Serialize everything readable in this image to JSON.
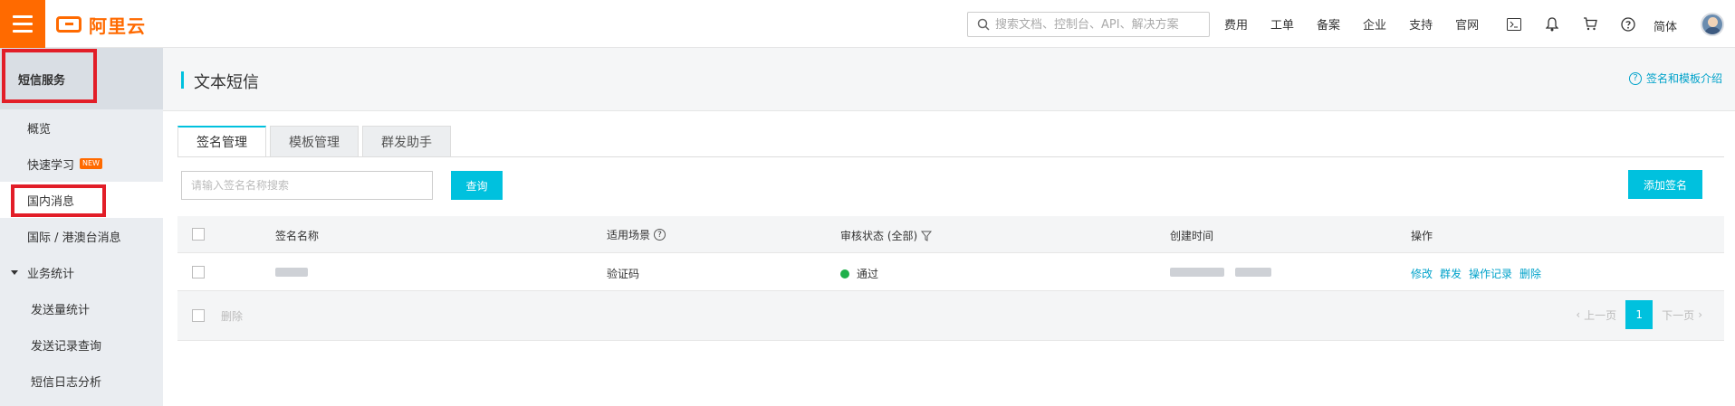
{
  "topbar": {
    "logo_text": "阿里云",
    "search_placeholder": "搜索文档、控制台、API、解决方案",
    "nav_items": [
      "费用",
      "工单",
      "备案",
      "企业",
      "支持",
      "官网"
    ],
    "icons": [
      "terminal-icon",
      "bell-icon",
      "cart-icon",
      "help-icon"
    ],
    "language": "简体"
  },
  "sidebar": {
    "title": "短信服务",
    "items": {
      "overview": "概览",
      "quick_learn": "快速学习",
      "quick_learn_badge": "NEW",
      "domestic": "国内消息",
      "international": "国际 / 港澳台消息",
      "stats_group": "业务统计",
      "send_stats": "发送量统计",
      "send_records": "发送记录查询",
      "log_analysis": "短信日志分析"
    }
  },
  "main": {
    "title": "文本短信",
    "intro_link": "签名和模板介绍",
    "tabs": [
      "签名管理",
      "模板管理",
      "群发助手"
    ],
    "search_placeholder": "请输入签名名称搜索",
    "query_button": "查询",
    "add_button": "添加签名",
    "table": {
      "headers": {
        "name": "签名名称",
        "scene": "适用场景",
        "status": "审核状态 (全部)",
        "created": "创建时间",
        "actions": "操作"
      },
      "rows": [
        {
          "scene": "验证码",
          "status": "通过",
          "actions": [
            "修改",
            "群发",
            "操作记录",
            "删除"
          ]
        }
      ],
      "footer_delete": "删除",
      "pager": {
        "prev": "上一页",
        "current": "1",
        "next": "下一页"
      }
    }
  },
  "colors": {
    "accent": "#00c1de",
    "brand": "#ff6a00",
    "link": "#00a2ca",
    "status_ok": "#1fb04a",
    "highlight": "#e21e28"
  }
}
